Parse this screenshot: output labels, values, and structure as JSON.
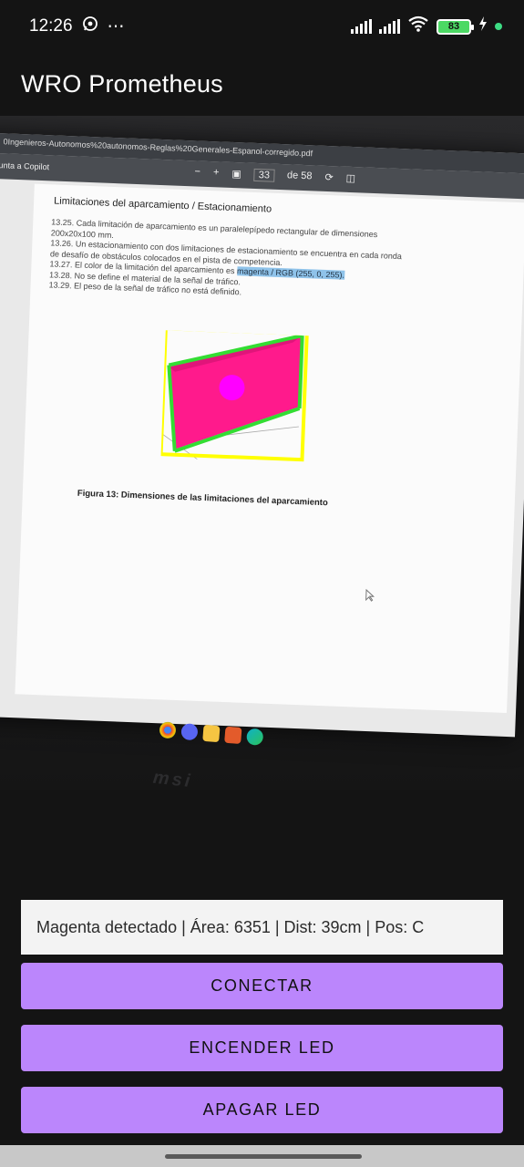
{
  "status_bar": {
    "time": "12:26",
    "extra": "⋯",
    "battery": "83"
  },
  "app": {
    "title": "WRO Prometheus"
  },
  "camera_feed": {
    "url": "0Ingenieros-Autonomos%20autonomos-Reglas%20Generales-Espanol-corregido.pdf",
    "copilot": "unta a Copilot",
    "page_num": "33",
    "page_total": "de 58",
    "heading": "Limitaciones del aparcamiento / Estacionamiento",
    "rules": [
      "13.25.  Cada limitación de aparcamiento es un paralelepípedo rectangular de dimensiones",
      "            200x20x100 mm.",
      "13.26.  Un estacionamiento con dos limitaciones de estacionamiento se encuentra en cada ronda",
      "            de desafío de obstáculos colocados en el pista de competencia.",
      "13.27.  El color de la limitación del aparcamiento es",
      "13.28.  No se define el material de la señal de tráfico.",
      "13.29.  El peso de la señal de tráfico no está definido."
    ],
    "highlight": "magenta / RGB (255, 0, 255).",
    "caption": "Figura 13: Dimensiones de las limitaciones del aparcamiento",
    "brand": "msi"
  },
  "detection": {
    "text": "Magenta detectado | Área: 6351 | Dist: 39cm | Pos: C"
  },
  "buttons": {
    "connect": "CONECTAR",
    "led_on": "ENCENDER LED",
    "led_off": "APAGAR LED"
  },
  "colors": {
    "accent": "#bb86fc",
    "background": "#141414",
    "detection_box": "#ffff00",
    "detected_object": "#ff1a8c",
    "target_dot": "#ff00ff",
    "edge_overlay": "#33dd33"
  }
}
